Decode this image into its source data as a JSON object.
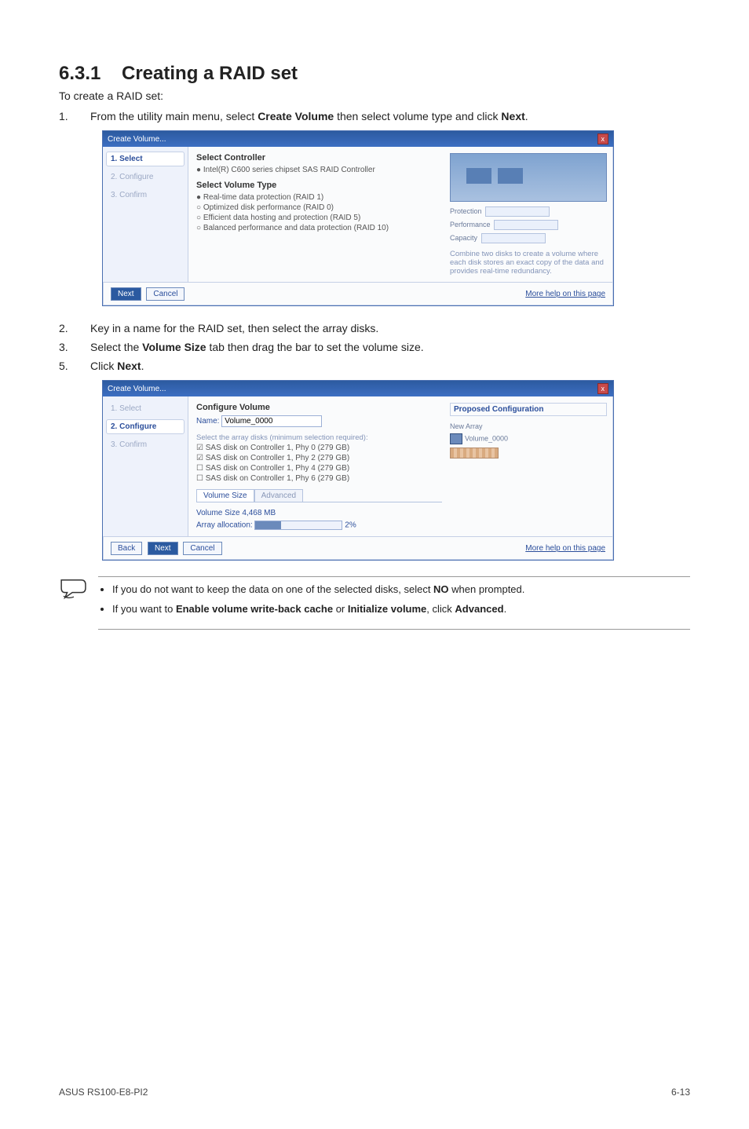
{
  "heading": {
    "number": "6.3.1",
    "title": "Creating a RAID set"
  },
  "intro": "To create a RAID set:",
  "steps": {
    "s1": {
      "n": "1.",
      "pre": "From the utility main menu, select ",
      "b1": "Create Volume",
      "mid": " then select volume type and click ",
      "b2": "Next",
      "post": "."
    },
    "s2": {
      "n": "2.",
      "t": "Key in a name for the RAID set, then select the array disks."
    },
    "s3": {
      "n": "3.",
      "pre": "Select the ",
      "b1": "Volume Size",
      "post": " tab then drag the bar to set the volume size."
    },
    "s5": {
      "n": "5.",
      "pre": "Click ",
      "b1": "Next",
      "post": "."
    }
  },
  "shot1": {
    "win_title": "Create Volume...",
    "close": "x",
    "side": {
      "s1": "1. Select",
      "s2": "2. Configure",
      "s3": "3. Confirm"
    },
    "hd1": "Select Controller",
    "ctrl": "Intel(R) C600 series chipset SAS RAID Controller",
    "hd2": "Select Volume Type",
    "r1": "Real-time data protection (RAID 1)",
    "r2": "Optimized disk performance (RAID 0)",
    "r3": "Efficient data hosting and protection (RAID 5)",
    "r4": "Balanced performance and data protection (RAID 10)",
    "info_p": "Protection",
    "info_f": "Performance",
    "info_c": "Capacity",
    "info_desc": "Combine two disks to create a volume where each disk stores an exact copy of the data and provides real-time redundancy.",
    "btn_next": "Next",
    "btn_cancel": "Cancel",
    "help": "More help on this page"
  },
  "shot2": {
    "win_title": "Create Volume...",
    "close": "x",
    "side": {
      "s1": "1. Select",
      "s2": "2. Configure",
      "s3": "3. Confirm"
    },
    "hd": "Configure Volume",
    "name_lbl": "Name:",
    "name_val": "Volume_0000",
    "disks_hd": "Select the array disks (minimum selection required):",
    "d1": "SAS disk on Controller 1, Phy 0 (279 GB)",
    "d2": "SAS disk on Controller 1, Phy 2 (279 GB)",
    "d3": "SAS disk on Controller 1, Phy 4 (279 GB)",
    "d4": "SAS disk on Controller 1, Phy 6 (279 GB)",
    "tab_vs": "Volume Size",
    "tab_adv": "Advanced",
    "vs_lbl": "Volume Size 4,468 MB",
    "alloc": "Array allocation:",
    "alloc_pct": "2% ",
    "prop_hd": "Proposed Configuration",
    "prop_arr": "New Array",
    "prop_vol": "Volume_0000",
    "btn_back": "Back",
    "btn_next": "Next",
    "btn_cancel": "Cancel",
    "help": "More help on this page"
  },
  "note": {
    "li1_pre": "If you do not want to keep the data on one of the selected disks, select ",
    "li1_b": "NO",
    "li1_post": " when prompted.",
    "li2_pre": "If you want to ",
    "li2_b1": "Enable volume write-back cache",
    "li2_mid": " or ",
    "li2_b2": "Initialize volume",
    "li2_post": ", click ",
    "li2_b3": "Advanced",
    "li2_end": "."
  },
  "footer": {
    "left": "ASUS RS100-E8-PI2",
    "right": "6-13"
  }
}
